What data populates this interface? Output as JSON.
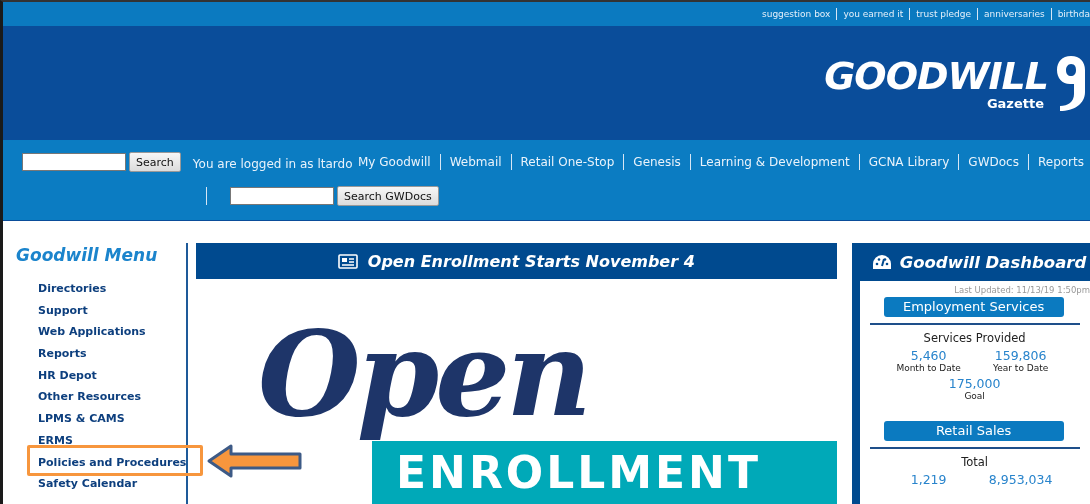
{
  "top_links": [
    "suggestion box",
    "you earned it",
    "trust pledge",
    "anniversaries",
    "birthda"
  ],
  "logo": {
    "name": "GOODWILL",
    "sub": "Gazette"
  },
  "search": {
    "button": "Search"
  },
  "login_text": "You are logged in as ltardo",
  "nav": [
    "My Goodwill",
    "Webmail",
    "Retail One-Stop",
    "Genesis",
    "Learning & Development",
    "GCNA Library",
    "GWDocs",
    "Reports"
  ],
  "docs_search": {
    "button": "Search GWDocs"
  },
  "sidebar": {
    "title": "Goodwill Menu",
    "items": [
      {
        "label": "Directories",
        "highlighted": false
      },
      {
        "label": "Support",
        "highlighted": false
      },
      {
        "label": "Web Applications",
        "highlighted": false
      },
      {
        "label": "Reports",
        "highlighted": false
      },
      {
        "label": "HR Depot",
        "highlighted": false
      },
      {
        "label": "Other Resources",
        "highlighted": false
      },
      {
        "label": "LPMS & CAMS",
        "highlighted": false
      },
      {
        "label": "ERMS",
        "highlighted": false
      },
      {
        "label": "Policies and Procedures",
        "highlighted": true
      },
      {
        "label": "Safety Calendar",
        "highlighted": false
      }
    ]
  },
  "feature": {
    "title": "Open Enrollment Starts November 4",
    "banner_script": "Open",
    "banner_word": "ENROLLMENT"
  },
  "dashboard": {
    "title": "Goodwill Dashboard",
    "updated": "Last Updated: 11/13/19 1:50pm",
    "sections": [
      {
        "title": "Employment Services",
        "subtitle": "Services Provided",
        "stats": [
          {
            "value": "5,460",
            "label": "Month to Date"
          },
          {
            "value": "159,806",
            "label": "Year to Date"
          },
          {
            "value": "175,000",
            "label": "Goal"
          }
        ]
      },
      {
        "title": "Retail Sales",
        "subtitle": "Total",
        "stats": [
          {
            "value": "1,219"
          },
          {
            "value": "8,953,034"
          }
        ]
      }
    ]
  }
}
